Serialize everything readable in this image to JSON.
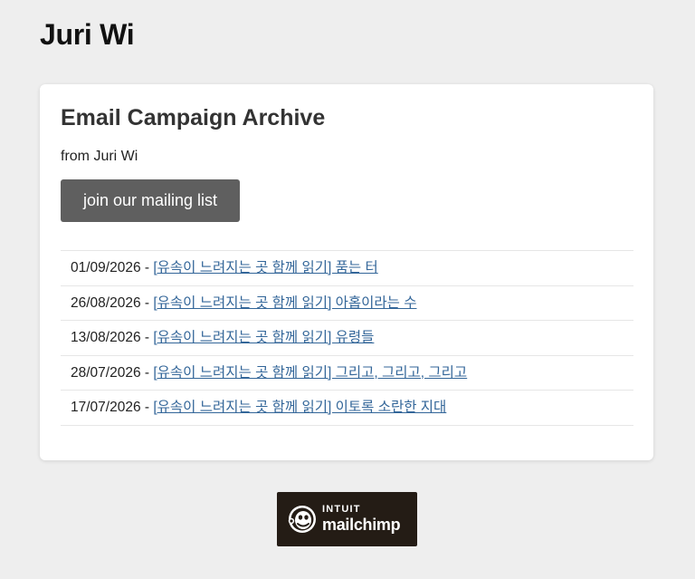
{
  "page": {
    "title": "Juri Wi"
  },
  "archive": {
    "heading": "Email Campaign Archive",
    "from_text": "from Juri Wi",
    "join_button_label": "join our mailing list",
    "campaigns": [
      {
        "date": "01/09/2026",
        "separator": " - ",
        "title": "[유속이 느려지는 곳  함께 읽기] 품는 터"
      },
      {
        "date": "26/08/2026",
        "separator": " - ",
        "title": "[유속이 느려지는 곳  함께 읽기] 아홉이라는 수"
      },
      {
        "date": "13/08/2026",
        "separator": " - ",
        "title": "[유속이 느려지는 곳  함께 읽기] 유령들"
      },
      {
        "date": "28/07/2026",
        "separator": " - ",
        "title": "[유속이 느려지는 곳  함께 읽기] 그리고, 그리고, 그리고"
      },
      {
        "date": "17/07/2026",
        "separator": " - ",
        "title": "[유속이 느려지는 곳  함께 읽기] 이토록 소란한 지대"
      }
    ]
  },
  "footer": {
    "badge_intuit": "INTUIT",
    "badge_mailchimp": "mailchimp",
    "badge_icon": "mailchimp-freddie-icon",
    "badge_color": "#241c15"
  },
  "colors": {
    "background": "#eeeeee",
    "card": "#ffffff",
    "button": "#5f5f5f",
    "link": "#336699"
  }
}
